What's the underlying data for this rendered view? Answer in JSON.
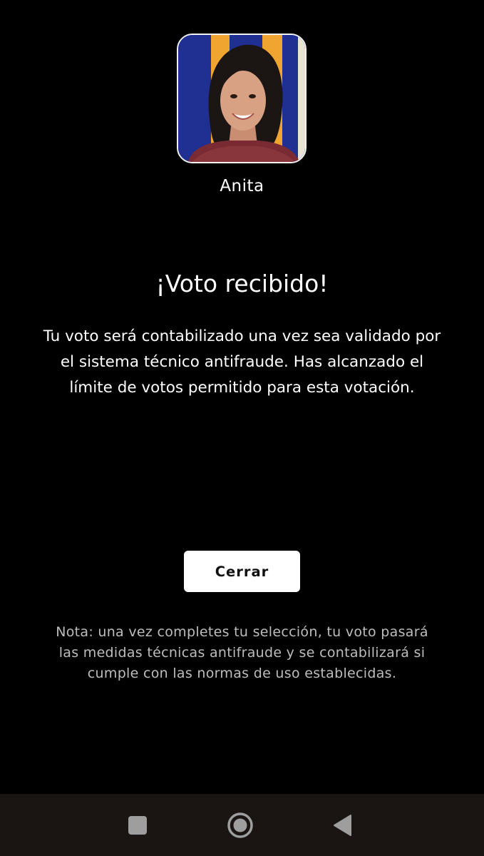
{
  "contestant": {
    "name": "Anita",
    "photo_background": "#1f2f92",
    "photo_accent": "#f0a531"
  },
  "confirmation": {
    "title": "¡Voto recibido!",
    "message": "Tu voto será contabilizado una vez sea validado por el sistema técnico antifraude. Has alcanzado el límite de votos permitido para esta votación."
  },
  "actions": {
    "close_label": "Cerrar"
  },
  "note": "Nota: una vez completes tu selección, tu voto pasará las medidas técnicas antifraude y se contabilizará si cumple con las normas de uso establecidas.",
  "navigation": {
    "recents_icon": "square-icon",
    "home_icon": "circle-icon",
    "back_icon": "triangle-back-icon"
  },
  "colors": {
    "background": "#000000",
    "button": "#ffffff",
    "note_text": "#bdbdbd",
    "nav_bar": "#1a1512"
  }
}
